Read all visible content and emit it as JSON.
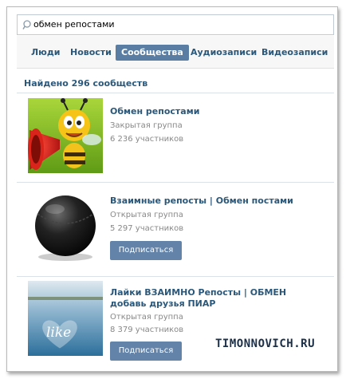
{
  "search": {
    "value": "обмен репостами",
    "icon": "search-icon"
  },
  "tabs": [
    {
      "label": "Люди",
      "active": false
    },
    {
      "label": "Новости",
      "active": false
    },
    {
      "label": "Сообщества",
      "active": true
    },
    {
      "label": "Аудиозаписи",
      "active": false
    },
    {
      "label": "Видеозаписи",
      "active": false
    }
  ],
  "summary": "Найдено 296 сообществ",
  "groups": [
    {
      "name": "Обмен репостами",
      "type": "Закрытая группа",
      "members": "6 236 участников",
      "join_label": ""
    },
    {
      "name": "Взаимные репосты | Обмен постами",
      "type": "Открытая группа",
      "members": "5 297 участников",
      "join_label": "Подписаться"
    },
    {
      "name": "Лайки ВЗАИМНО Репосты | ОБМЕН добавь друзья ПИАР",
      "type": "Открытая группа",
      "members": "8 379 участников",
      "join_label": "Подписаться",
      "avatar_text": "like"
    }
  ],
  "watermark": "TIMONNOVICH.RU",
  "colors": {
    "accent": "#597da3",
    "link": "#2b587a",
    "muted": "#888888",
    "button": "#6383a8"
  }
}
